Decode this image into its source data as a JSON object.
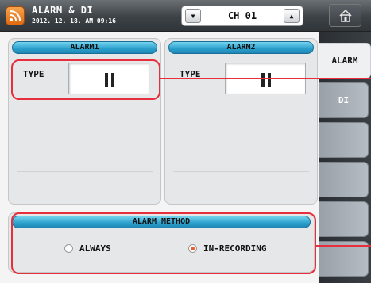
{
  "header": {
    "title": "ALARM & DI",
    "datetime": "2012. 12. 18. AM 09:16",
    "channel": "CH 01",
    "prev_symbol": "▼",
    "next_symbol": "▲"
  },
  "tabs": [
    {
      "label": "ALARM",
      "active": true
    },
    {
      "label": "DI",
      "active": false
    },
    {
      "label": "",
      "active": false
    },
    {
      "label": "",
      "active": false
    },
    {
      "label": "",
      "active": false
    },
    {
      "label": "",
      "active": false
    }
  ],
  "alarm1": {
    "heading": "ALARM1",
    "type_label": "TYPE",
    "type_icon": "pause-icon"
  },
  "alarm2": {
    "heading": "ALARM2",
    "type_label": "TYPE",
    "type_icon": "pause-icon"
  },
  "alarm_method": {
    "heading": "ALARM METHOD",
    "options": [
      {
        "label": "ALWAYS",
        "selected": false
      },
      {
        "label": "IN-RECORDING",
        "selected": true
      }
    ]
  },
  "colors": {
    "accent_blue": "#2b9fcc",
    "highlight_red": "#e62e3c",
    "radio_selected": "#f05a2a"
  }
}
